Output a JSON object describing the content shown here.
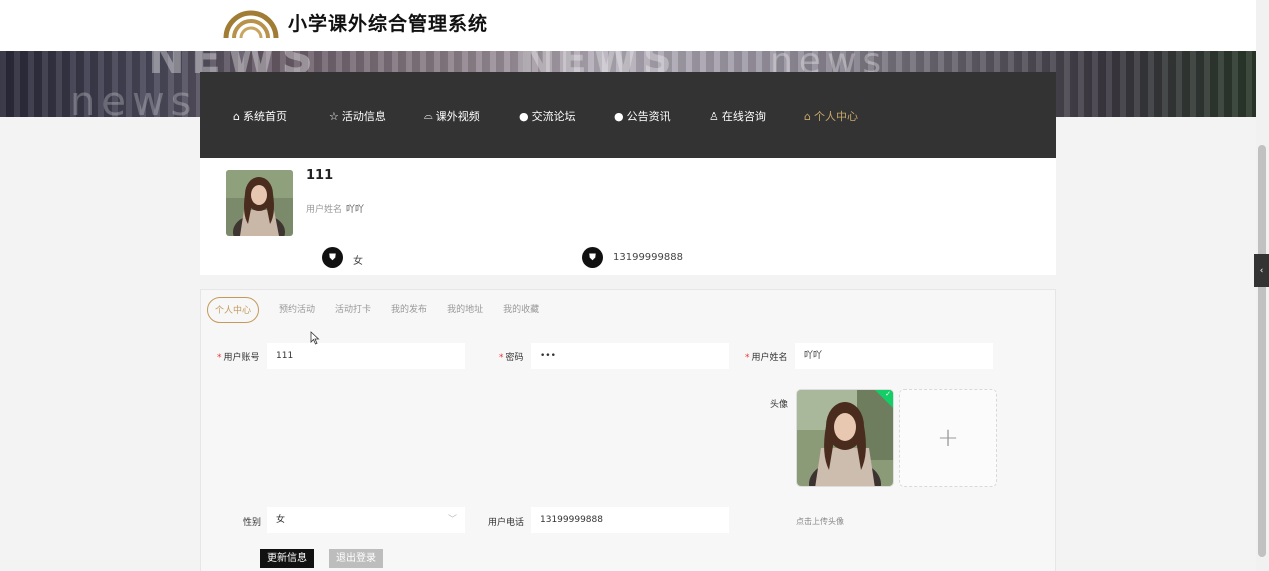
{
  "header": {
    "site_title": "小学课外综合管理系统",
    "logo_icon": "arch-logo-icon"
  },
  "banner": {
    "words": [
      "NEWS",
      "news",
      "NEWS",
      "news"
    ]
  },
  "nav": {
    "items": [
      {
        "label": "系统首页",
        "icon": "home-icon",
        "glyph": "⌂"
      },
      {
        "label": "活动信息",
        "icon": "star-icon",
        "glyph": "☆"
      },
      {
        "label": "课外视频",
        "icon": "bag-icon",
        "glyph": "⌓"
      },
      {
        "label": "交流论坛",
        "icon": "info-icon",
        "glyph": "●"
      },
      {
        "label": "公告资讯",
        "icon": "info-icon",
        "glyph": "●"
      },
      {
        "label": "在线咨询",
        "icon": "user-icon",
        "glyph": "♙"
      },
      {
        "label": "个人中心",
        "icon": "home-icon",
        "glyph": "⌂"
      }
    ],
    "active_index": 6,
    "active_color": "#c8a86a"
  },
  "profile": {
    "account": "111",
    "realname_label": "用户姓名",
    "realname": "吖吖",
    "gender": "女",
    "phone": "13199999888"
  },
  "tabs": [
    "个人中心",
    "预约活动",
    "活动打卡",
    "我的发布",
    "我的地址",
    "我的收藏"
  ],
  "form": {
    "account_label": "用户账号",
    "account_value": "111",
    "password_label": "密码",
    "password_value": "•••",
    "realname_label": "用户姓名",
    "realname_value": "吖吖",
    "avatar_label": "头像",
    "gender_label": "性别",
    "gender_value": "女",
    "phone_label": "用户电话",
    "phone_value": "13199999888",
    "upload_hint": "点击上传头像",
    "upload_plus": "+",
    "update_button": "更新信息",
    "logout_button": "退出登录"
  },
  "colors": {
    "accent": "#c49a5a",
    "nav_bg": "#333333",
    "success": "#13ce66"
  }
}
